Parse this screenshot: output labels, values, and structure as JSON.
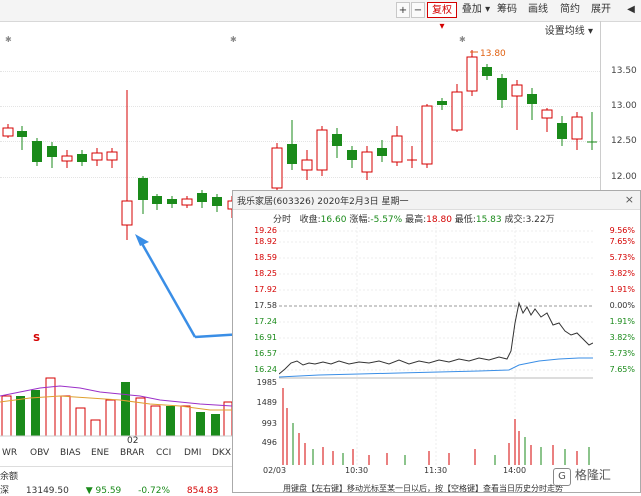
{
  "toolbar": {
    "buttons": [
      "+",
      "−",
      "复权",
      "叠加",
      "筹码",
      "画线",
      "简约",
      "展开"
    ],
    "arrow": "◀"
  },
  "main_chart": {
    "settings_label": "设置均线",
    "y_ticks": [
      "13.50",
      "13.00",
      "12.50",
      "12.00"
    ],
    "high_label": "13.80",
    "s_marker": "S",
    "colors": {
      "up": "#d40000",
      "down": "#1a8a1a",
      "accent_line": "#9b30c8"
    }
  },
  "indicator_tabs": [
    "WR",
    "OBV",
    "BIAS",
    "ENE",
    "BRAR",
    "CCI",
    "DMI",
    "DKX"
  ],
  "date_label": "02",
  "bottom_bar": {
    "label": "余额",
    "row": [
      "深",
      "13149.50",
      "▼",
      "95.59",
      "-0.72%",
      "854.83"
    ]
  },
  "popup": {
    "title": "我乐家居(603326)  2020年2月3日  星期一",
    "close": "×",
    "info": {
      "tab": "分时",
      "close_label": "收盘",
      "close_value": "16.60",
      "change_label": "涨幅",
      "change_value": "-5.57%",
      "high_label": "最高",
      "high_value": "18.80",
      "low_label": "最低",
      "low_value": "15.83",
      "volume_label": "成交",
      "volume_value": "3.22万"
    },
    "price_ticks": [
      "19.26",
      "18.92",
      "18.59",
      "18.25",
      "17.92",
      "17.58",
      "17.24",
      "16.91",
      "16.57",
      "16.24"
    ],
    "pct_ticks": [
      "9.56%",
      "7.65%",
      "5.73%",
      "3.82%",
      "1.91%",
      "0.00%",
      "1.91%",
      "3.82%",
      "5.73%",
      "7.65%"
    ],
    "volume_ticks": [
      "1985",
      "1489",
      "993",
      "496"
    ],
    "time_ticks": [
      "02/03",
      "10:30",
      "11:30",
      "14:00"
    ],
    "footer": "用键盘【左右键】移动光标至某一日以后，按【空格键】查看当日历史分时走势"
  },
  "watermark": "格隆汇"
}
